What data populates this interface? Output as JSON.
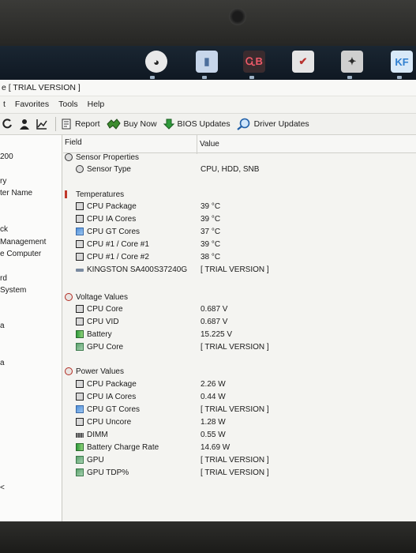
{
  "desktop": {
    "icons": [
      {
        "name": "app-icon-1",
        "glyph": "◕",
        "color": "#2a2a2a"
      },
      {
        "name": "app-icon-2",
        "glyph": "▮",
        "color": "#4d6f9c"
      },
      {
        "name": "app-icon-3",
        "glyph": "ᏩB",
        "color": "#c63a4a"
      },
      {
        "name": "app-icon-4",
        "glyph": "✔",
        "color": "#b8322f"
      },
      {
        "name": "app-icon-5",
        "glyph": "✦",
        "color": "#2b2b2b"
      },
      {
        "name": "app-icon-6",
        "glyph": "KF",
        "color": "#2f7fd0"
      }
    ]
  },
  "window": {
    "title": "e [ TRIAL VERSION ]",
    "menu": [
      "t",
      "Favorites",
      "Tools",
      "Help"
    ],
    "toolbar": {
      "report": "Report",
      "buy_now": "Buy Now",
      "bios_updates": "BIOS Updates",
      "driver_updates": "Driver Updates"
    }
  },
  "left_pane": [
    "200",
    "ry",
    "ter Name",
    "ck",
    "Management",
    "e Computer",
    "rd",
    "System",
    "a",
    "a",
    "<"
  ],
  "table": {
    "col_field": "Field",
    "col_value": "Value",
    "rows": [
      {
        "type": "group",
        "label": "Sensor Properties",
        "icon": "sensor-properties-icon",
        "value": ""
      },
      {
        "type": "item",
        "label": "Sensor Type",
        "icon": "sensor-type-icon",
        "value": "CPU, HDD, SNB"
      },
      {
        "type": "group",
        "label": "Temperatures",
        "icon": "thermometer-icon",
        "value": ""
      },
      {
        "type": "item",
        "label": "CPU Package",
        "icon": "cpu-chip-icon",
        "value": "39 °C"
      },
      {
        "type": "item",
        "label": "CPU IA Cores",
        "icon": "cpu-chip-icon",
        "value": "39 °C"
      },
      {
        "type": "item",
        "label": "CPU GT Cores",
        "icon": "gpu-cores-icon",
        "value": "37 °C"
      },
      {
        "type": "item",
        "label": "CPU #1 / Core #1",
        "icon": "cpu-chip-icon",
        "value": "39 °C"
      },
      {
        "type": "item",
        "label": "CPU #1 / Core #2",
        "icon": "cpu-chip-icon",
        "value": "38 °C"
      },
      {
        "type": "item",
        "label": "KINGSTON SA400S37240G",
        "icon": "ssd-icon",
        "value": "[ TRIAL VERSION ]"
      },
      {
        "type": "group",
        "label": "Voltage Values",
        "icon": "voltage-icon",
        "value": ""
      },
      {
        "type": "item",
        "label": "CPU Core",
        "icon": "cpu-chip-icon",
        "value": "0.687 V"
      },
      {
        "type": "item",
        "label": "CPU VID",
        "icon": "cpu-chip-icon",
        "value": "0.687 V"
      },
      {
        "type": "item",
        "label": "Battery",
        "icon": "battery-icon",
        "value": "15.225 V"
      },
      {
        "type": "item",
        "label": "GPU Core",
        "icon": "gpu-icon",
        "value": "[ TRIAL VERSION ]"
      },
      {
        "type": "group",
        "label": "Power Values",
        "icon": "power-icon",
        "value": ""
      },
      {
        "type": "item",
        "label": "CPU Package",
        "icon": "cpu-chip-icon",
        "value": "2.26 W"
      },
      {
        "type": "item",
        "label": "CPU IA Cores",
        "icon": "cpu-chip-icon",
        "value": "0.44 W"
      },
      {
        "type": "item",
        "label": "CPU GT Cores",
        "icon": "gpu-cores-icon",
        "value": "[ TRIAL VERSION ]"
      },
      {
        "type": "item",
        "label": "CPU Uncore",
        "icon": "cpu-chip-icon",
        "value": "1.28 W"
      },
      {
        "type": "item",
        "label": "DIMM",
        "icon": "dimm-icon",
        "value": "0.55 W"
      },
      {
        "type": "item",
        "label": "Battery Charge Rate",
        "icon": "battery-icon",
        "value": "14.69 W"
      },
      {
        "type": "item",
        "label": "GPU",
        "icon": "gpu-icon",
        "value": "[ TRIAL VERSION ]"
      },
      {
        "type": "item",
        "label": "GPU TDP%",
        "icon": "gpu-icon",
        "value": "[ TRIAL VERSION ]"
      }
    ]
  }
}
